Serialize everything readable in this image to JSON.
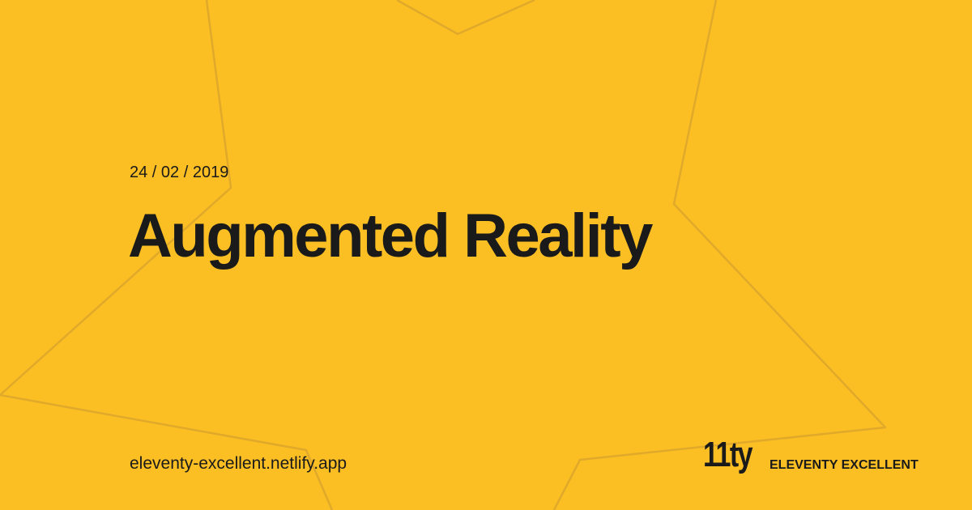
{
  "colors": {
    "background": "#fbbf24",
    "star_stroke": "#e0a92a",
    "text": "#1a1a1a"
  },
  "post": {
    "date": "24 / 02 / 2019",
    "title": "Augmented Reality"
  },
  "footer": {
    "site_url": "eleventy-excellent.netlify.app",
    "brand_logo_text": "11ty",
    "brand_name": "ELEVENTY EXCELLENT"
  },
  "icons": {
    "background": "star-outline-icon",
    "logo": "eleventy-logo-icon"
  }
}
